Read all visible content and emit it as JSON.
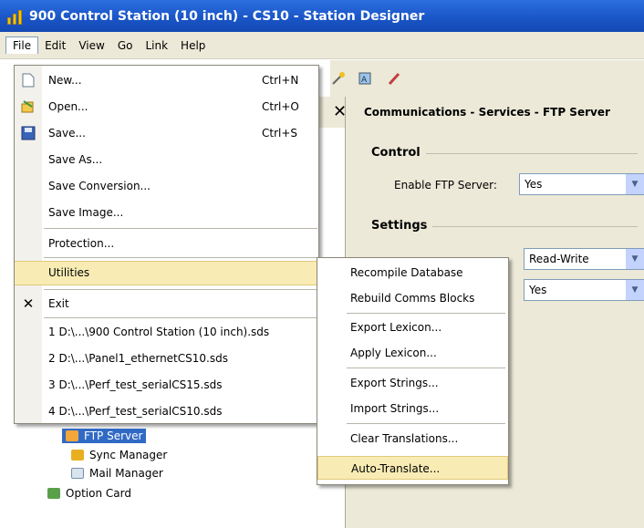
{
  "window": {
    "title": "900 Control Station (10 inch) - CS10 - Station Designer"
  },
  "menubar": [
    "File",
    "Edit",
    "View",
    "Go",
    "Link",
    "Help"
  ],
  "file_menu": {
    "new": {
      "label": "New...",
      "shortcut": "Ctrl+N"
    },
    "open": {
      "label": "Open...",
      "shortcut": "Ctrl+O"
    },
    "save": {
      "label": "Save...",
      "shortcut": "Ctrl+S"
    },
    "save_as": "Save As...",
    "save_conversion": "Save Conversion...",
    "save_image": "Save Image...",
    "protection": "Protection...",
    "utilities": "Utilities",
    "exit": "Exit",
    "recent": [
      "1 D:\\...\\900 Control Station (10 inch).sds",
      "2 D:\\...\\Panel1_ethernetCS10.sds",
      "3 D:\\...\\Perf_test_serialCS15.sds",
      "4 D:\\...\\Perf_test_serialCS10.sds"
    ]
  },
  "utilities_menu": [
    "Recompile Database",
    "Rebuild Comms Blocks",
    "Export Lexicon...",
    "Apply Lexicon...",
    "Export Strings...",
    "Import Strings...",
    "Clear Translations...",
    "Auto-Translate..."
  ],
  "tree": {
    "ftp_server": "FTP Server",
    "sync_manager": "Sync Manager",
    "mail_manager": "Mail Manager",
    "option_card": "Option Card"
  },
  "panel": {
    "close": "✕",
    "title": "Communications - Services - FTP Server",
    "control_group": "Control",
    "enable_label": "Enable FTP Server:",
    "enable_value": "Yes",
    "settings_group": "Settings",
    "access_value": "Read-Write",
    "second_value": "Yes"
  },
  "colors": {
    "titlebar": "#1a56c8",
    "menu_highlight": "#f8ecb4",
    "tree_selection": "#316ac5"
  }
}
